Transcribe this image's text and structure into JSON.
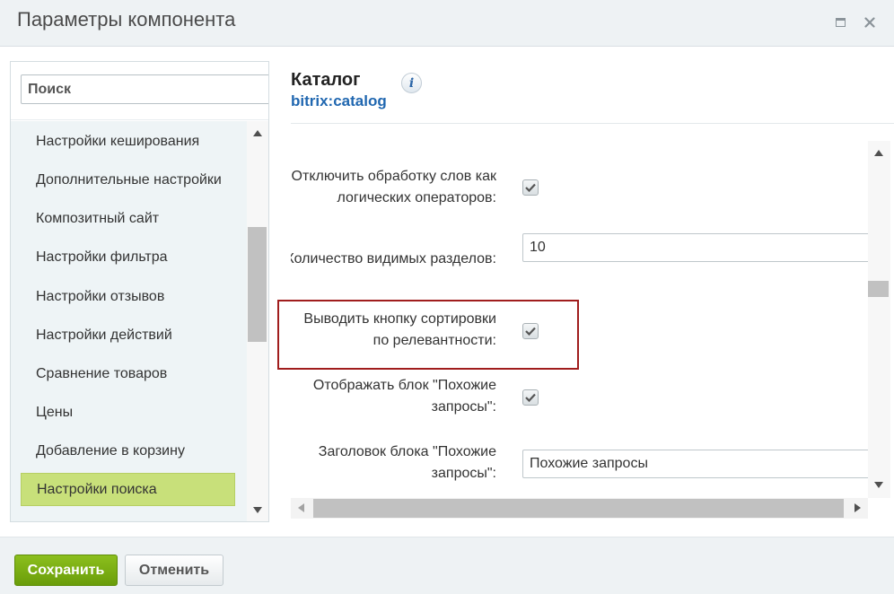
{
  "window": {
    "title": "Параметры компонента",
    "maximize_icon": "maximize-icon",
    "close_icon": "close-icon",
    "close_glyph": "✕"
  },
  "sidebar": {
    "search_placeholder": "Поиск",
    "items": [
      {
        "label": "Настройки кеширования"
      },
      {
        "label": "Дополнительные настройки"
      },
      {
        "label": "Композитный сайт"
      },
      {
        "label": "Настройки фильтра"
      },
      {
        "label": "Настройки отзывов"
      },
      {
        "label": "Настройки действий"
      },
      {
        "label": "Сравнение товаров"
      },
      {
        "label": "Цены"
      },
      {
        "label": "Добавление в корзину"
      },
      {
        "label": "Настройки поиска",
        "active": true
      }
    ]
  },
  "component": {
    "name": "Каталог",
    "id": "bitrix:catalog",
    "info_glyph": "i"
  },
  "form": {
    "fields": [
      {
        "label_lines": [
          "Отключить обработку слов как",
          "логических операторов:"
        ],
        "type": "checkbox",
        "checked": true
      },
      {
        "label_lines": [
          "Количество видимых разделов:"
        ],
        "type": "text",
        "value": "10"
      },
      {
        "label_lines": [
          "Выводить кнопку сортировки",
          "по релевантности:"
        ],
        "type": "checkbox",
        "checked": true,
        "highlighted": true
      },
      {
        "label_lines": [
          "Отображать блок \"Похожие",
          "запросы\":"
        ],
        "type": "checkbox",
        "checked": true
      },
      {
        "label_lines": [
          "Заголовок блока \"Похожие",
          "запросы\":"
        ],
        "type": "text",
        "value": "Похожие запросы"
      }
    ]
  },
  "footer": {
    "save_label": "Сохранить",
    "cancel_label": "Отменить"
  },
  "colors": {
    "accent_green": "#7aad12",
    "active_item": "#c8e07a",
    "highlight_border": "#a01d1d",
    "link_blue": "#2067b0"
  }
}
